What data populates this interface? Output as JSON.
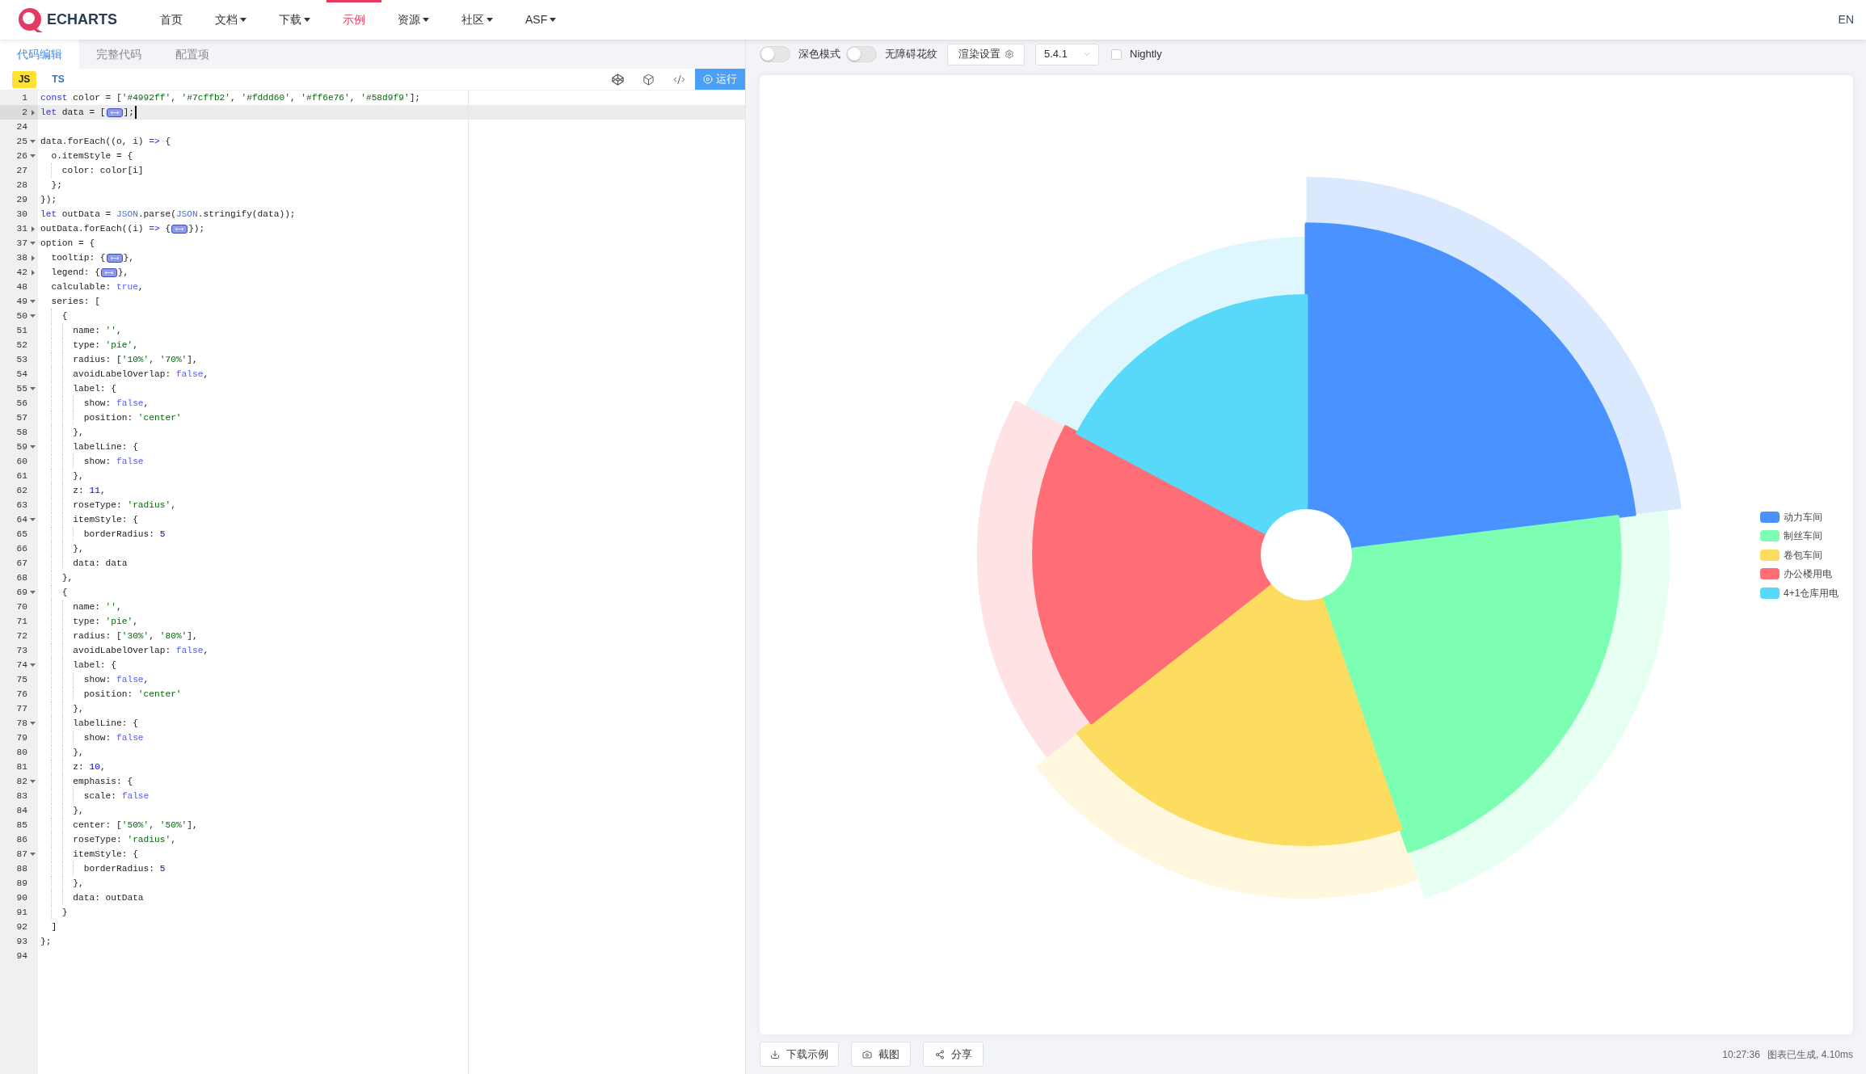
{
  "nav": {
    "logo_text": "ECHARTS",
    "items": [
      {
        "label": "首页",
        "kind": "link",
        "selected": false
      },
      {
        "label": "文档",
        "kind": "menu",
        "selected": false
      },
      {
        "label": "下载",
        "kind": "menu",
        "selected": false
      },
      {
        "label": "示例",
        "kind": "link",
        "selected": true
      },
      {
        "label": "资源",
        "kind": "menu",
        "selected": false
      },
      {
        "label": "社区",
        "kind": "menu",
        "selected": false
      },
      {
        "label": "ASF",
        "kind": "menu",
        "selected": false
      }
    ],
    "language": "EN"
  },
  "editor": {
    "tabs": [
      {
        "label": "代码编辑",
        "selected": true
      },
      {
        "label": "完整代码",
        "selected": false
      },
      {
        "label": "配置项",
        "selected": false
      }
    ],
    "languages": [
      {
        "label": "JS",
        "selected": true
      },
      {
        "label": "TS",
        "selected": false
      }
    ],
    "run_button": "运行",
    "lines": [
      {
        "number": "1",
        "tokens": [
          {
            "kind": "keyword",
            "text": "const"
          },
          {
            "kind": "plain",
            "text": " color = ["
          },
          {
            "kind": "string",
            "text": "'#4992ff'"
          },
          {
            "kind": "plain",
            "text": ", "
          },
          {
            "kind": "string",
            "text": "'#7cffb2'"
          },
          {
            "kind": "plain",
            "text": ", "
          },
          {
            "kind": "string",
            "text": "'#fddd60'"
          },
          {
            "kind": "plain",
            "text": ", "
          },
          {
            "kind": "string",
            "text": "'#ff6e76'"
          },
          {
            "kind": "plain",
            "text": ", "
          },
          {
            "kind": "string",
            "text": "'#58d9f9'"
          },
          {
            "kind": "plain",
            "text": "];"
          }
        ]
      },
      {
        "number": "2",
        "expanded": false,
        "tokens": [
          {
            "kind": "keyword",
            "text": "let"
          },
          {
            "kind": "plain",
            "text": " data = ["
          },
          {
            "kind": "fold"
          },
          {
            "kind": "plain",
            "text": "];"
          },
          {
            "kind": "cursor"
          }
        ]
      },
      {
        "number": "24"
      },
      {
        "number": "25",
        "expanded": true,
        "tokens": [
          {
            "kind": "plain",
            "text": "data.forEach((o, i) "
          },
          {
            "kind": "keyword",
            "text": "=>"
          },
          {
            "kind": "plain",
            "text": " {"
          }
        ],
        "children": [
          {
            "number": "26",
            "expanded": true,
            "tokens": [
              {
                "kind": "plain",
                "text": "o.itemStyle = {"
              }
            ],
            "children": [
              {
                "number": "27",
                "tokens": [
                  {
                    "kind": "plain",
                    "text": "color: color[i]"
                  }
                ]
              }
            ]
          },
          {
            "number": "28",
            "tokens": [
              {
                "kind": "plain",
                "text": "};"
              }
            ]
          }
        ]
      },
      {
        "number": "29",
        "tokens": [
          {
            "kind": "plain",
            "text": "});"
          }
        ]
      },
      {
        "number": "30",
        "tokens": [
          {
            "kind": "keyword",
            "text": "let"
          },
          {
            "kind": "plain",
            "text": " outData = "
          },
          {
            "kind": "builtin",
            "text": "JSON"
          },
          {
            "kind": "plain",
            "text": ".parse("
          },
          {
            "kind": "builtin",
            "text": "JSON"
          },
          {
            "kind": "plain",
            "text": ".stringify(data));"
          }
        ]
      },
      {
        "number": "31",
        "expanded": false,
        "tokens": [
          {
            "kind": "plain",
            "text": "outData.forEach((i) "
          },
          {
            "kind": "keyword",
            "text": "=>"
          },
          {
            "kind": "plain",
            "text": " {"
          },
          {
            "kind": "fold"
          },
          {
            "kind": "plain",
            "text": "});"
          }
        ]
      },
      {
        "number": "37",
        "expanded": true,
        "tokens": [
          {
            "kind": "plain",
            "text": "option = {"
          }
        ],
        "children": [
          {
            "number": "38",
            "expanded": false,
            "tokens": [
              {
                "kind": "plain",
                "text": "tooltip: {"
              },
              {
                "kind": "fold"
              },
              {
                "kind": "plain",
                "text": "},"
              }
            ]
          },
          {
            "number": "42",
            "expanded": false,
            "tokens": [
              {
                "kind": "plain",
                "text": "legend: {"
              },
              {
                "kind": "fold"
              },
              {
                "kind": "plain",
                "text": "},"
              }
            ]
          },
          {
            "number": "48",
            "tokens": [
              {
                "kind": "plain",
                "text": "calculable: "
              },
              {
                "kind": "boolean",
                "text": "true"
              },
              {
                "kind": "plain",
                "text": ","
              }
            ]
          },
          {
            "number": "49",
            "expanded": true,
            "tokens": [
              {
                "kind": "plain",
                "text": "series: ["
              }
            ],
            "children": [
              {
                "number": "50",
                "expanded": true,
                "tokens": [
                  {
                    "kind": "plain",
                    "text": "{"
                  }
                ],
                "children": [
                  {
                    "number": "51",
                    "tokens": [
                      {
                        "kind": "plain",
                        "text": "name: "
                      },
                      {
                        "kind": "string",
                        "text": "''"
                      },
                      {
                        "kind": "plain",
                        "text": ","
                      }
                    ]
                  },
                  {
                    "number": "52",
                    "tokens": [
                      {
                        "kind": "plain",
                        "text": "type: "
                      },
                      {
                        "kind": "string",
                        "text": "'pie'"
                      },
                      {
                        "kind": "plain",
                        "text": ","
                      }
                    ]
                  },
                  {
                    "number": "53",
                    "tokens": [
                      {
                        "kind": "plain",
                        "text": "radius: ["
                      },
                      {
                        "kind": "string",
                        "text": "'10%'"
                      },
                      {
                        "kind": "plain",
                        "text": ", "
                      },
                      {
                        "kind": "string",
                        "text": "'70%'"
                      },
                      {
                        "kind": "plain",
                        "text": "],"
                      }
                    ]
                  },
                  {
                    "number": "54",
                    "tokens": [
                      {
                        "kind": "plain",
                        "text": "avoidLabelOverlap: "
                      },
                      {
                        "kind": "boolean",
                        "text": "false"
                      },
                      {
                        "kind": "plain",
                        "text": ","
                      }
                    ]
                  },
                  {
                    "number": "55",
                    "expanded": true,
                    "tokens": [
                      {
                        "kind": "plain",
                        "text": "label: {"
                      }
                    ],
                    "children": [
                      {
                        "number": "56",
                        "tokens": [
                          {
                            "kind": "plain",
                            "text": "show: "
                          },
                          {
                            "kind": "boolean",
                            "text": "false"
                          },
                          {
                            "kind": "plain",
                            "text": ","
                          }
                        ]
                      },
                      {
                        "number": "57",
                        "tokens": [
                          {
                            "kind": "plain",
                            "text": "position: "
                          },
                          {
                            "kind": "string",
                            "text": "'center'"
                          }
                        ]
                      }
                    ]
                  },
                  {
                    "number": "58",
                    "tokens": [
                      {
                        "kind": "plain",
                        "text": "},"
                      }
                    ]
                  },
                  {
                    "number": "59",
                    "expanded": true,
                    "tokens": [
                      {
                        "kind": "plain",
                        "text": "labelLine: {"
                      }
                    ],
                    "children": [
                      {
                        "number": "60",
                        "tokens": [
                          {
                            "kind": "plain",
                            "text": "show: "
                          },
                          {
                            "kind": "boolean",
                            "text": "false"
                          }
                        ]
                      }
                    ]
                  },
                  {
                    "number": "61",
                    "tokens": [
                      {
                        "kind": "plain",
                        "text": "},"
                      }
                    ]
                  },
                  {
                    "number": "62",
                    "tokens": [
                      {
                        "kind": "plain",
                        "text": "z: "
                      },
                      {
                        "kind": "number",
                        "text": "11"
                      },
                      {
                        "kind": "plain",
                        "text": ","
                      }
                    ]
                  },
                  {
                    "number": "63",
                    "tokens": [
                      {
                        "kind": "plain",
                        "text": "roseType: "
                      },
                      {
                        "kind": "string",
                        "text": "'radius'"
                      },
                      {
                        "kind": "plain",
                        "text": ","
                      }
                    ]
                  },
                  {
                    "number": "64",
                    "expanded": true,
                    "tokens": [
                      {
                        "kind": "plain",
                        "text": "itemStyle: {"
                      }
                    ],
                    "children": [
                      {
                        "number": "65",
                        "tokens": [
                          {
                            "kind": "plain",
                            "text": "borderRadius: "
                          },
                          {
                            "kind": "number",
                            "text": "5"
                          }
                        ]
                      }
                    ]
                  },
                  {
                    "number": "66",
                    "tokens": [
                      {
                        "kind": "plain",
                        "text": "},"
                      }
                    ]
                  },
                  {
                    "number": "67",
                    "tokens": [
                      {
                        "kind": "plain",
                        "text": "data: data"
                      }
                    ]
                  }
                ]
              },
              {
                "number": "68",
                "tokens": [
                  {
                    "kind": "plain",
                    "text": "},"
                  }
                ]
              },
              {
                "number": "69",
                "expanded": true,
                "tokens": [
                  {
                    "kind": "plain",
                    "text": "{"
                  }
                ],
                "children": [
                  {
                    "number": "70",
                    "tokens": [
                      {
                        "kind": "plain",
                        "text": "name: "
                      },
                      {
                        "kind": "string",
                        "text": "''"
                      },
                      {
                        "kind": "plain",
                        "text": ","
                      }
                    ]
                  },
                  {
                    "number": "71",
                    "tokens": [
                      {
                        "kind": "plain",
                        "text": "type: "
                      },
                      {
                        "kind": "string",
                        "text": "'pie'"
                      },
                      {
                        "kind": "plain",
                        "text": ","
                      }
                    ]
                  },
                  {
                    "number": "72",
                    "tokens": [
                      {
                        "kind": "plain",
                        "text": "radius: ["
                      },
                      {
                        "kind": "string",
                        "text": "'30%'"
                      },
                      {
                        "kind": "plain",
                        "text": ", "
                      },
                      {
                        "kind": "string",
                        "text": "'80%'"
                      },
                      {
                        "kind": "plain",
                        "text": "],"
                      }
                    ]
                  },
                  {
                    "number": "73",
                    "tokens": [
                      {
                        "kind": "plain",
                        "text": "avoidLabelOverlap: "
                      },
                      {
                        "kind": "boolean",
                        "text": "false"
                      },
                      {
                        "kind": "plain",
                        "text": ","
                      }
                    ]
                  },
                  {
                    "number": "74",
                    "expanded": true,
                    "tokens": [
                      {
                        "kind": "plain",
                        "text": "label: {"
                      }
                    ],
                    "children": [
                      {
                        "number": "75",
                        "tokens": [
                          {
                            "kind": "plain",
                            "text": "show: "
                          },
                          {
                            "kind": "boolean",
                            "text": "false"
                          },
                          {
                            "kind": "plain",
                            "text": ","
                          }
                        ]
                      },
                      {
                        "number": "76",
                        "tokens": [
                          {
                            "kind": "plain",
                            "text": "position: "
                          },
                          {
                            "kind": "string",
                            "text": "'center'"
                          }
                        ]
                      }
                    ]
                  },
                  {
                    "number": "77",
                    "tokens": [
                      {
                        "kind": "plain",
                        "text": "},"
                      }
                    ]
                  },
                  {
                    "number": "78",
                    "expanded": true,
                    "tokens": [
                      {
                        "kind": "plain",
                        "text": "labelLine: {"
                      }
                    ],
                    "children": [
                      {
                        "number": "79",
                        "tokens": [
                          {
                            "kind": "plain",
                            "text": "show: "
                          },
                          {
                            "kind": "boolean",
                            "text": "false"
                          }
                        ]
                      }
                    ]
                  },
                  {
                    "number": "80",
                    "tokens": [
                      {
                        "kind": "plain",
                        "text": "},"
                      }
                    ]
                  },
                  {
                    "number": "81",
                    "tokens": [
                      {
                        "kind": "plain",
                        "text": "z: "
                      },
                      {
                        "kind": "number",
                        "text": "10"
                      },
                      {
                        "kind": "plain",
                        "text": ","
                      }
                    ]
                  },
                  {
                    "number": "82",
                    "expanded": true,
                    "tokens": [
                      {
                        "kind": "plain",
                        "text": "emphasis: {"
                      }
                    ],
                    "children": [
                      {
                        "number": "83",
                        "tokens": [
                          {
                            "kind": "plain",
                            "text": "scale: "
                          },
                          {
                            "kind": "boolean",
                            "text": "false"
                          }
                        ]
                      }
                    ]
                  },
                  {
                    "number": "84",
                    "tokens": [
                      {
                        "kind": "plain",
                        "text": "},"
                      }
                    ]
                  },
                  {
                    "number": "85",
                    "tokens": [
                      {
                        "kind": "plain",
                        "text": "center: ["
                      },
                      {
                        "kind": "string",
                        "text": "'50%'"
                      },
                      {
                        "kind": "plain",
                        "text": ", "
                      },
                      {
                        "kind": "string",
                        "text": "'50%'"
                      },
                      {
                        "kind": "plain",
                        "text": "],"
                      }
                    ]
                  },
                  {
                    "number": "86",
                    "tokens": [
                      {
                        "kind": "plain",
                        "text": "roseType: "
                      },
                      {
                        "kind": "string",
                        "text": "'radius'"
                      },
                      {
                        "kind": "plain",
                        "text": ","
                      }
                    ]
                  },
                  {
                    "number": "87",
                    "expanded": true,
                    "tokens": [
                      {
                        "kind": "plain",
                        "text": "itemStyle: {"
                      }
                    ],
                    "children": [
                      {
                        "number": "88",
                        "tokens": [
                          {
                            "kind": "plain",
                            "text": "borderRadius: "
                          },
                          {
                            "kind": "number",
                            "text": "5"
                          }
                        ]
                      }
                    ]
                  },
                  {
                    "number": "89",
                    "tokens": [
                      {
                        "kind": "plain",
                        "text": "},"
                      }
                    ]
                  },
                  {
                    "number": "90",
                    "tokens": [
                      {
                        "kind": "plain",
                        "text": "data: outData"
                      }
                    ]
                  }
                ]
              },
              {
                "number": "91",
                "tokens": [
                  {
                    "kind": "plain",
                    "text": "}"
                  }
                ]
              }
            ]
          },
          {
            "number": "92",
            "tokens": [
              {
                "kind": "plain",
                "text": "]"
              }
            ]
          }
        ]
      },
      {
        "number": "93",
        "tokens": [
          {
            "kind": "plain",
            "text": "};"
          }
        ]
      },
      {
        "number": "94"
      }
    ]
  },
  "preview": {
    "toolbar": {
      "switches": [
        {
          "label": "深色模式",
          "on": false
        },
        {
          "label": "无障碍花纹",
          "on": false
        }
      ],
      "render_settings": "渲染设置",
      "version": "5.4.1",
      "nightly": {
        "label": "Nightly",
        "checked": false
      }
    },
    "legend": [
      {
        "name": "动力车间",
        "color": "#4992ff"
      },
      {
        "name": "制丝车间",
        "color": "#7cffb2"
      },
      {
        "name": "卷包车间",
        "color": "#fddd60"
      },
      {
        "name": "办公楼用电",
        "color": "#ff6e76"
      },
      {
        "name": "4+1仓库用电",
        "color": "#58d9f9"
      }
    ],
    "actions": [
      {
        "label": "下载示例",
        "kind": "download"
      },
      {
        "label": "截图",
        "kind": "screenshot"
      },
      {
        "label": "分享",
        "kind": "share"
      }
    ],
    "status": {
      "time": "10:27:36",
      "message": "图表已生成, 4.10ms"
    }
  }
}
